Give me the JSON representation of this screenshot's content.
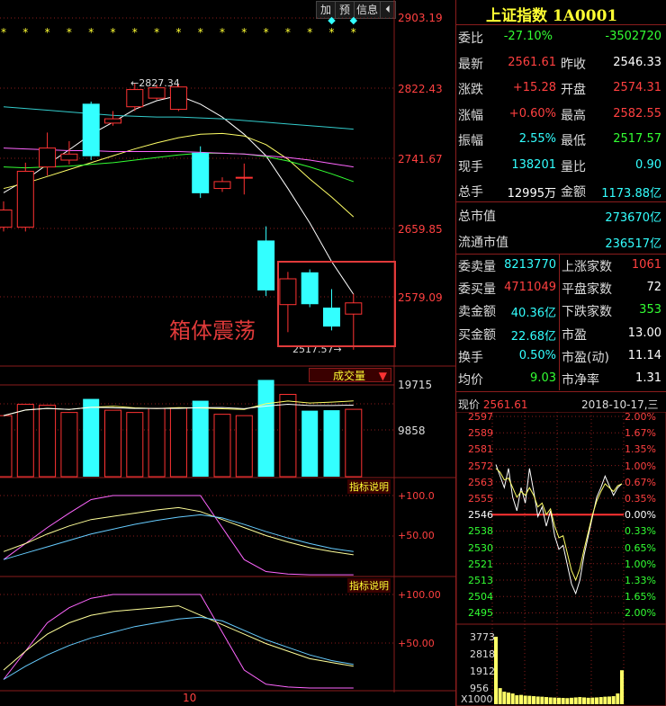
{
  "toolbar": {
    "add": "加",
    "predict": "预",
    "info": "信息"
  },
  "kline": {
    "price_axis": [
      "2903.19",
      "2822.43",
      "2741.67",
      "2659.85",
      "2579.09"
    ],
    "high_label": "2827.34",
    "low_label": "2517.57",
    "annotation": "箱体震荡",
    "star_glyph": "*"
  },
  "volume": {
    "title": "成交量",
    "axis": [
      "19715",
      "9858"
    ]
  },
  "indicator1": {
    "title": "指标说明",
    "axis": [
      "+100.0",
      "+50.00"
    ]
  },
  "indicator2": {
    "title": "指标说明",
    "axis": [
      "+100.00",
      "+50.00"
    ]
  },
  "date_label": "10",
  "quote": {
    "title": "上证指数 1A0001",
    "rows": [
      {
        "k": "委比",
        "v1": "-27.10%",
        "c1": "green",
        "v2": "-3502720",
        "c2": "green"
      },
      {
        "k": "最新",
        "v1": "2561.61",
        "c1": "red",
        "k2": "昨收",
        "v2": "2546.33",
        "c2": "white"
      },
      {
        "k": "涨跌",
        "v1": "+15.28",
        "c1": "red",
        "k2": "开盘",
        "v2": "2574.31",
        "c2": "red"
      },
      {
        "k": "涨幅",
        "v1": "+0.60%",
        "c1": "red",
        "k2": "最高",
        "v2": "2582.55",
        "c2": "red"
      },
      {
        "k": "振幅",
        "v1": "2.55%",
        "c1": "cyan",
        "k2": "最低",
        "v2": "2517.57",
        "c2": "green"
      },
      {
        "k": "现手",
        "v1": "138201",
        "c1": "cyan",
        "k2": "量比",
        "v2": "0.90",
        "c2": "cyan"
      },
      {
        "k": "总手",
        "v1": "12995万",
        "c1": "white",
        "k2": "金额",
        "v2": "1173.88亿",
        "c2": "cyan"
      }
    ],
    "cap_rows": [
      {
        "k": "总市值",
        "v": "273670亿"
      },
      {
        "k": "流通市值",
        "v": "236517亿"
      }
    ],
    "book_rows": [
      {
        "k": "委卖量",
        "v1": "8213770",
        "c1": "cyan",
        "k2": "上涨家数",
        "v2": "1061",
        "c2": "red"
      },
      {
        "k": "委买量",
        "v1": "4711049",
        "c1": "red",
        "k2": "平盘家数",
        "v2": "72",
        "c2": "white"
      },
      {
        "k": "卖金额",
        "v1": "40.36亿",
        "c1": "cyan",
        "k2": "下跌家数",
        "v2": "353",
        "c2": "green"
      },
      {
        "k": "买金额",
        "v1": "22.68亿",
        "c1": "cyan",
        "k2": "市盈",
        "v2": "13.00",
        "c2": "white"
      },
      {
        "k": "换手",
        "v1": "0.50%",
        "c1": "cyan",
        "k2": "市盈(动)",
        "v2": "11.14",
        "c2": "white"
      },
      {
        "k": "均价",
        "v1": "9.03",
        "c1": "green",
        "k2": "市净率",
        "v2": "1.31",
        "c2": "white"
      }
    ]
  },
  "intraday": {
    "label": "现价",
    "price": "2561.61",
    "date": "2018-10-17,三",
    "left_axis": [
      "2597",
      "2589",
      "2581",
      "2572",
      "2563",
      "2555",
      "2546",
      "2538",
      "2530",
      "2521",
      "2513",
      "2504",
      "2495"
    ],
    "right_axis": [
      "2.00%",
      "1.67%",
      "1.35%",
      "1.00%",
      "0.67%",
      "0.35%",
      "0.00%",
      "0.33%",
      "0.65%",
      "1.00%",
      "1.33%",
      "1.65%",
      "2.00%"
    ],
    "vol_axis": [
      "3773",
      "2818",
      "1912",
      "956"
    ],
    "vol_unit": "X1000"
  },
  "chart_data": {
    "type": "candlestick",
    "ylim": [
      2503,
      2903.19
    ],
    "candles": [
      {
        "o": 2660,
        "c": 2680,
        "h": 2690,
        "l": 2655
      },
      {
        "o": 2660,
        "c": 2725,
        "h": 2735,
        "l": 2655
      },
      {
        "o": 2730,
        "c": 2752,
        "h": 2770,
        "l": 2720
      },
      {
        "o": 2738,
        "c": 2745,
        "h": 2760,
        "l": 2733
      },
      {
        "o": 2803,
        "c": 2743,
        "h": 2806,
        "l": 2738
      },
      {
        "o": 2781,
        "c": 2786,
        "h": 2795,
        "l": 2778
      },
      {
        "o": 2800,
        "c": 2820,
        "h": 2827.34,
        "l": 2795
      },
      {
        "o": 2810,
        "c": 2822,
        "h": 2826,
        "l": 2808
      },
      {
        "o": 2797,
        "c": 2823,
        "h": 2826,
        "l": 2795
      },
      {
        "o": 2746,
        "c": 2700,
        "h": 2754,
        "l": 2694
      },
      {
        "o": 2705,
        "c": 2713,
        "h": 2718,
        "l": 2701
      },
      {
        "o": 2717,
        "c": 2718,
        "h": 2734,
        "l": 2698
      },
      {
        "o": 2644,
        "c": 2587,
        "h": 2661,
        "l": 2580
      },
      {
        "o": 2570,
        "c": 2600,
        "h": 2608,
        "l": 2538
      },
      {
        "o": 2607,
        "c": 2571,
        "h": 2611,
        "l": 2567
      },
      {
        "o": 2566,
        "c": 2545,
        "h": 2588,
        "l": 2540
      },
      {
        "o": 2559,
        "c": 2572,
        "h": 2582.55,
        "l": 2517.57
      }
    ],
    "ma": [
      {
        "values": [
          2700,
          2715,
          2733,
          2750,
          2768,
          2782,
          2797,
          2807,
          2813,
          2803,
          2788,
          2768,
          2743,
          2705,
          2665,
          2620,
          2582
        ]
      },
      {
        "values": [
          2705,
          2711,
          2719,
          2727,
          2735,
          2743,
          2751,
          2758,
          2764,
          2768,
          2769,
          2766,
          2756,
          2739,
          2716,
          2695,
          2672
        ]
      },
      {
        "values": [
          2730,
          2729,
          2730,
          2731,
          2733,
          2735,
          2738,
          2741,
          2744,
          2746,
          2746,
          2745,
          2742,
          2737,
          2730,
          2722,
          2713
        ]
      },
      {
        "values": [
          2752,
          2751,
          2750,
          2749,
          2749,
          2748,
          2748,
          2748,
          2748,
          2747,
          2746,
          2745,
          2743,
          2741,
          2738,
          2734,
          2730
        ]
      },
      {
        "values": [
          2800,
          2798,
          2796,
          2794,
          2792,
          2790,
          2789,
          2788,
          2788,
          2787,
          2786,
          2784,
          2782,
          2780,
          2778,
          2776,
          2774
        ]
      }
    ],
    "volume": [
      13500,
      16000,
      15800,
      14200,
      17200,
      14700,
      14200,
      15100,
      15200,
      16800,
      13800,
      13500,
      21400,
      18200,
      14600,
      14700,
      14900
    ],
    "indicator1": [
      {
        "values": [
          20,
          40,
          60,
          78,
          95,
          100,
          100,
          100,
          100,
          100,
          60,
          20,
          5,
          2,
          1,
          1,
          1
        ]
      },
      {
        "values": [
          30,
          40,
          52,
          62,
          70,
          74,
          78,
          82,
          85,
          80,
          70,
          60,
          50,
          42,
          35,
          30,
          26
        ]
      },
      {
        "values": [
          20,
          28,
          36,
          44,
          52,
          58,
          64,
          69,
          73,
          76,
          72,
          64,
          55,
          47,
          40,
          34,
          30
        ]
      }
    ],
    "indicator2": [
      {
        "values": [
          10,
          40,
          70,
          86,
          96,
          100,
          100,
          100,
          100,
          100,
          60,
          20,
          5,
          2,
          1,
          1,
          1
        ]
      },
      {
        "values": [
          20,
          40,
          58,
          70,
          78,
          82,
          84,
          86,
          88,
          78,
          68,
          58,
          48,
          40,
          32,
          28,
          24
        ]
      },
      {
        "values": [
          10,
          24,
          36,
          46,
          54,
          60,
          66,
          70,
          74,
          76,
          72,
          62,
          52,
          44,
          36,
          30,
          26
        ]
      }
    ],
    "intraday_price": [
      2572,
      2566,
      2560,
      2570,
      2555,
      2548,
      2560,
      2552,
      2570,
      2558,
      2545,
      2550,
      2540,
      2548,
      2535,
      2528,
      2530,
      2520,
      2510,
      2505,
      2512,
      2525,
      2535,
      2545,
      2555,
      2560,
      2566,
      2561,
      2556,
      2560,
      2562
    ],
    "intraday_avg": [
      2570,
      2568,
      2564,
      2565,
      2560,
      2555,
      2558,
      2556,
      2560,
      2556,
      2550,
      2552,
      2546,
      2549,
      2540,
      2534,
      2535,
      2526,
      2517,
      2512,
      2518,
      2528,
      2537,
      2546,
      2553,
      2558,
      2562,
      2560,
      2558,
      2561,
      2562
    ],
    "intraday_volume": [
      3773,
      900,
      700,
      650,
      600,
      500,
      520,
      480,
      470,
      450,
      430,
      420,
      400,
      380,
      370,
      360,
      350,
      340,
      360,
      380,
      400,
      380,
      360,
      370,
      380,
      400,
      420,
      430,
      450,
      600,
      1900
    ]
  }
}
